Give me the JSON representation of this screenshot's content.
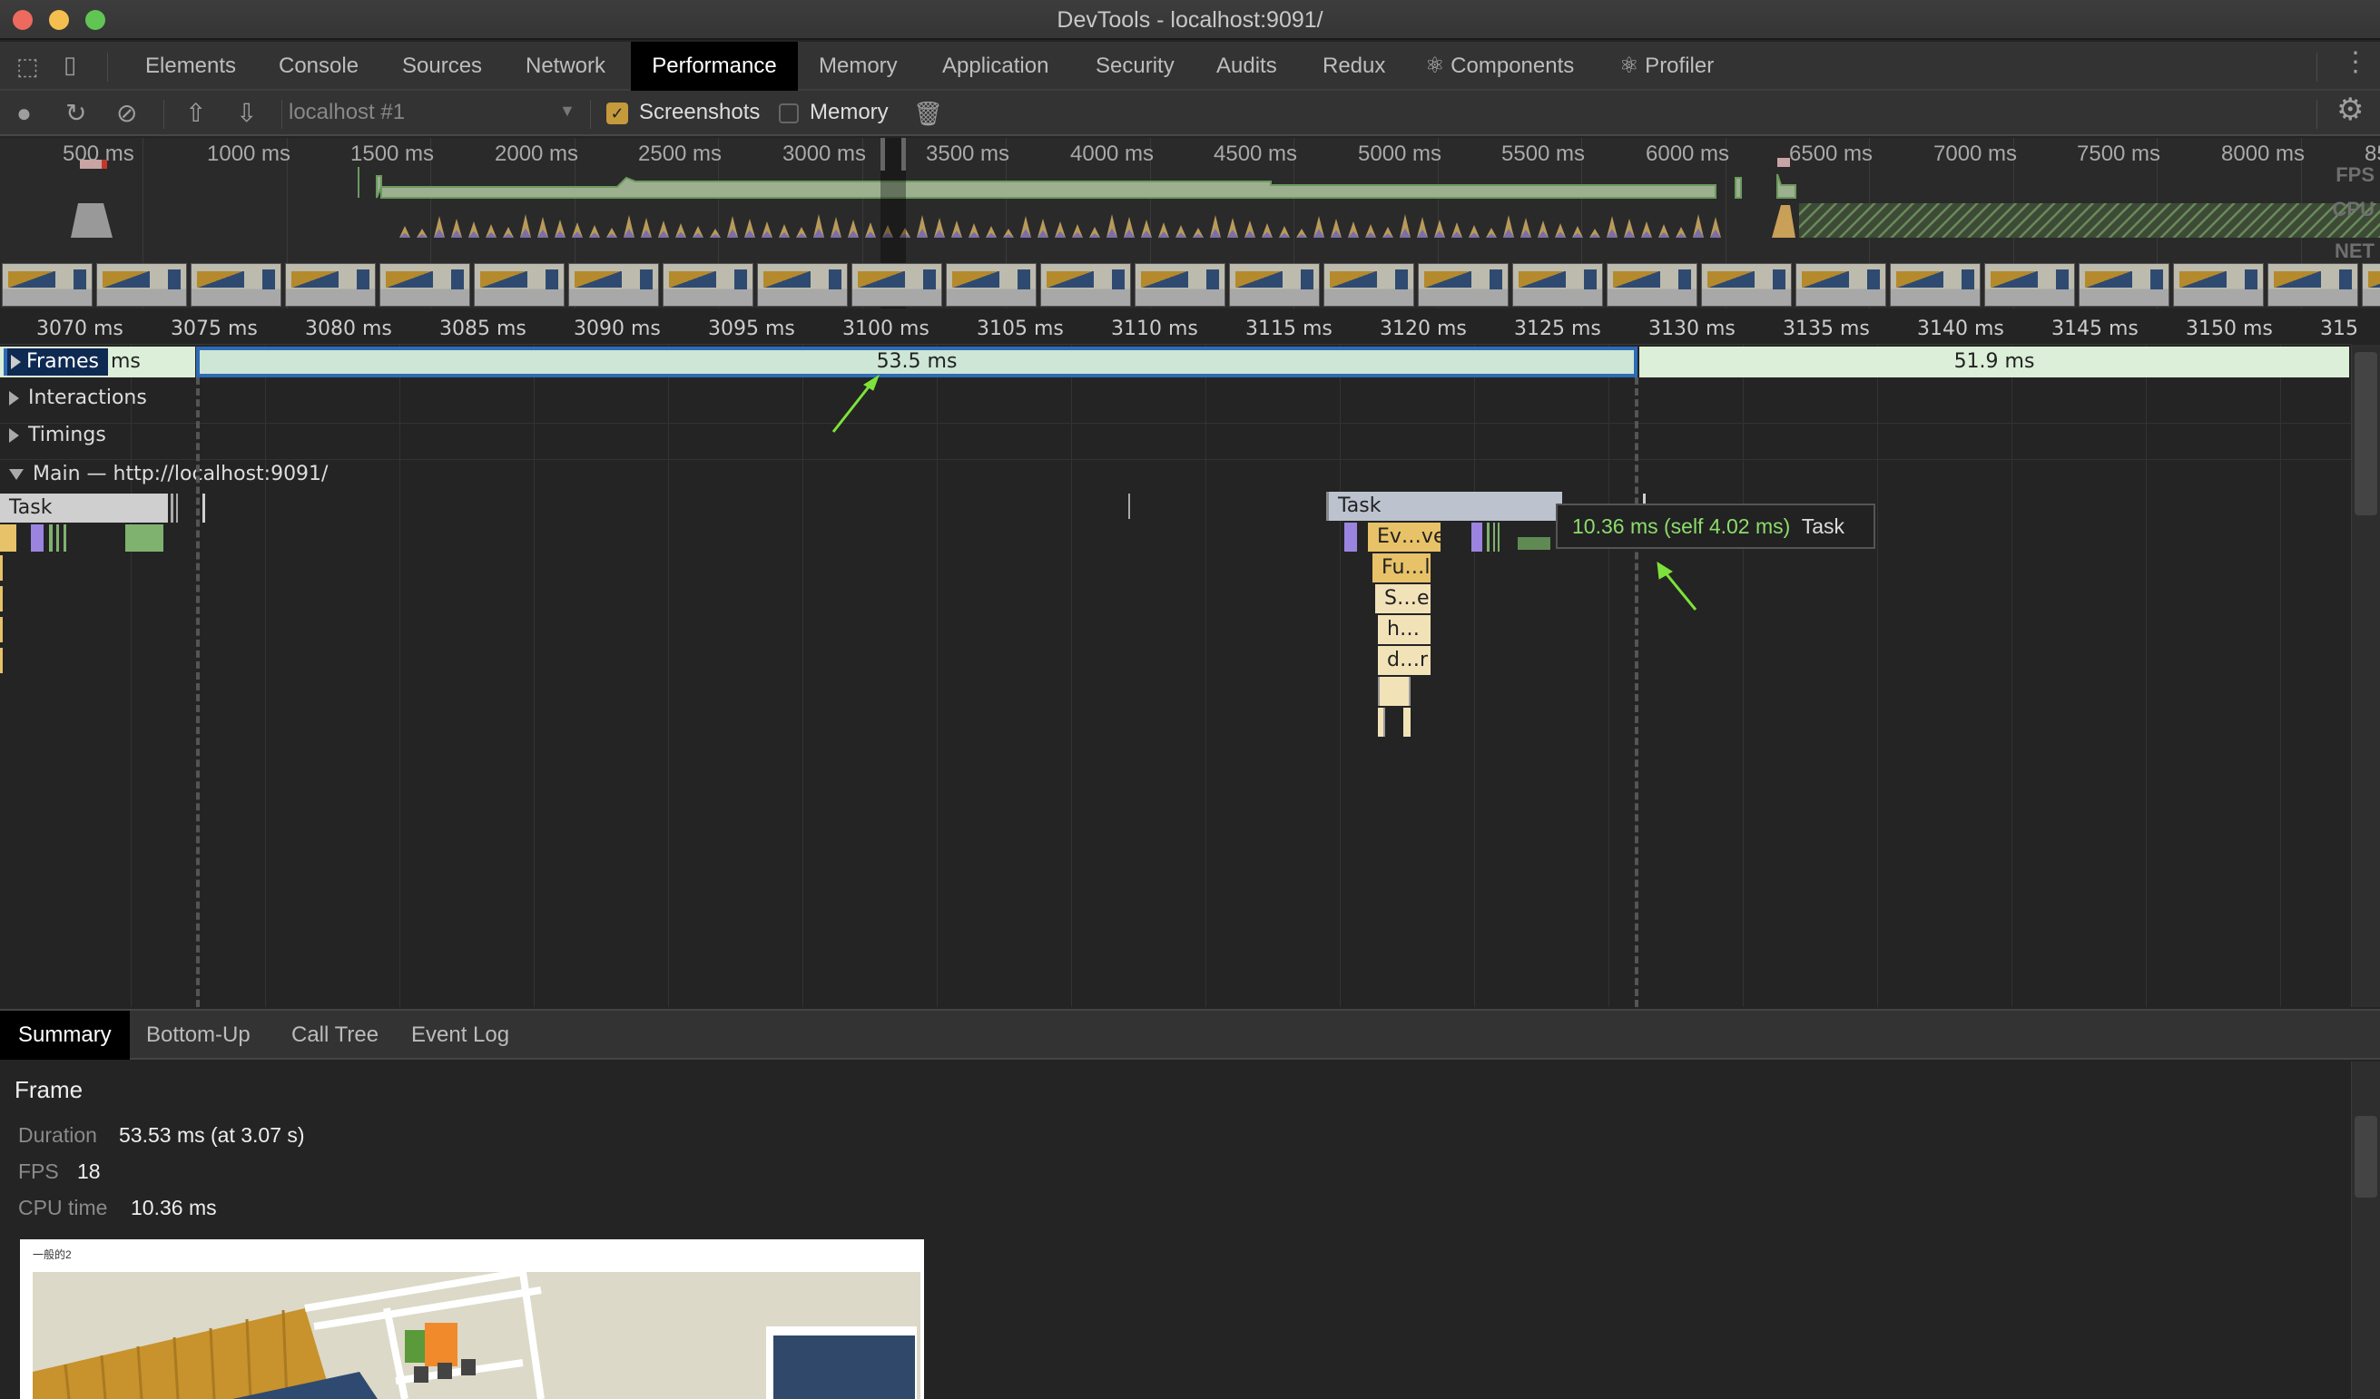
{
  "window": {
    "title": "DevTools - localhost:9091/"
  },
  "tabs": [
    {
      "label": "Elements"
    },
    {
      "label": "Console"
    },
    {
      "label": "Sources"
    },
    {
      "label": "Network"
    },
    {
      "label": "Performance",
      "active": true
    },
    {
      "label": "Memory"
    },
    {
      "label": "Application"
    },
    {
      "label": "Security"
    },
    {
      "label": "Audits"
    },
    {
      "label": "Redux"
    },
    {
      "label": "⚛ Components"
    },
    {
      "label": "⚛ Profiler"
    }
  ],
  "toolbar": {
    "profile_select": "localhost #1",
    "screenshots_label": "Screenshots",
    "screenshots_checked": true,
    "memory_label": "Memory",
    "memory_checked": false
  },
  "overview": {
    "ticks": [
      "500 ms",
      "1000 ms",
      "1500 ms",
      "2000 ms",
      "2500 ms",
      "3000 ms",
      "3500 ms",
      "4000 ms",
      "4500 ms",
      "5000 ms",
      "5500 ms",
      "6000 ms",
      "6500 ms",
      "7000 ms",
      "7500 ms",
      "8000 ms",
      "85"
    ],
    "lanes": [
      "FPS",
      "CPU",
      "NET"
    ]
  },
  "ruler": {
    "ticks": [
      "3070 ms",
      "3075 ms",
      "3080 ms",
      "3085 ms",
      "3090 ms",
      "3095 ms",
      "3100 ms",
      "3105 ms",
      "3110 ms",
      "3115 ms",
      "3120 ms",
      "3125 ms",
      "3130 ms",
      "3135 ms",
      "3140 ms",
      "3145 ms",
      "3150 ms",
      "315"
    ]
  },
  "tracks": {
    "frames": "Frames",
    "frames_prev_suffix": "ms",
    "frame_selected": "53.5 ms",
    "frame_next": "51.9 ms",
    "interactions": "Interactions",
    "timings": "Timings",
    "main": "Main — http://localhost:9091/"
  },
  "flame": {
    "task_left": "Task",
    "task_right": "Task",
    "calls": [
      "Ev…ve",
      "Fu…l",
      "S…e",
      "h…",
      "d…r"
    ]
  },
  "tooltip": {
    "time": "10.36 ms (self 4.02 ms)",
    "name": "Task"
  },
  "bottom_tabs": [
    {
      "label": "Summary",
      "active": true
    },
    {
      "label": "Bottom-Up"
    },
    {
      "label": "Call Tree"
    },
    {
      "label": "Event Log"
    }
  ],
  "summary": {
    "title": "Frame",
    "rows": [
      {
        "label": "Duration",
        "value": "53.53 ms (at 3.07 s)"
      },
      {
        "label": "FPS",
        "value": "18"
      },
      {
        "label": "CPU time",
        "value": "10.36 ms"
      }
    ],
    "screenshot_caption": "一般的2"
  },
  "colors": {
    "scripting": "#e8c268",
    "scripting_light": "#f2e2b8",
    "rendering": "#9b84e0",
    "painting": "#7fb26f",
    "frame_fill": "#dcefd8",
    "frame_selected_border": "#2d6bb5",
    "annotation_arrow": "#7ee23a"
  }
}
